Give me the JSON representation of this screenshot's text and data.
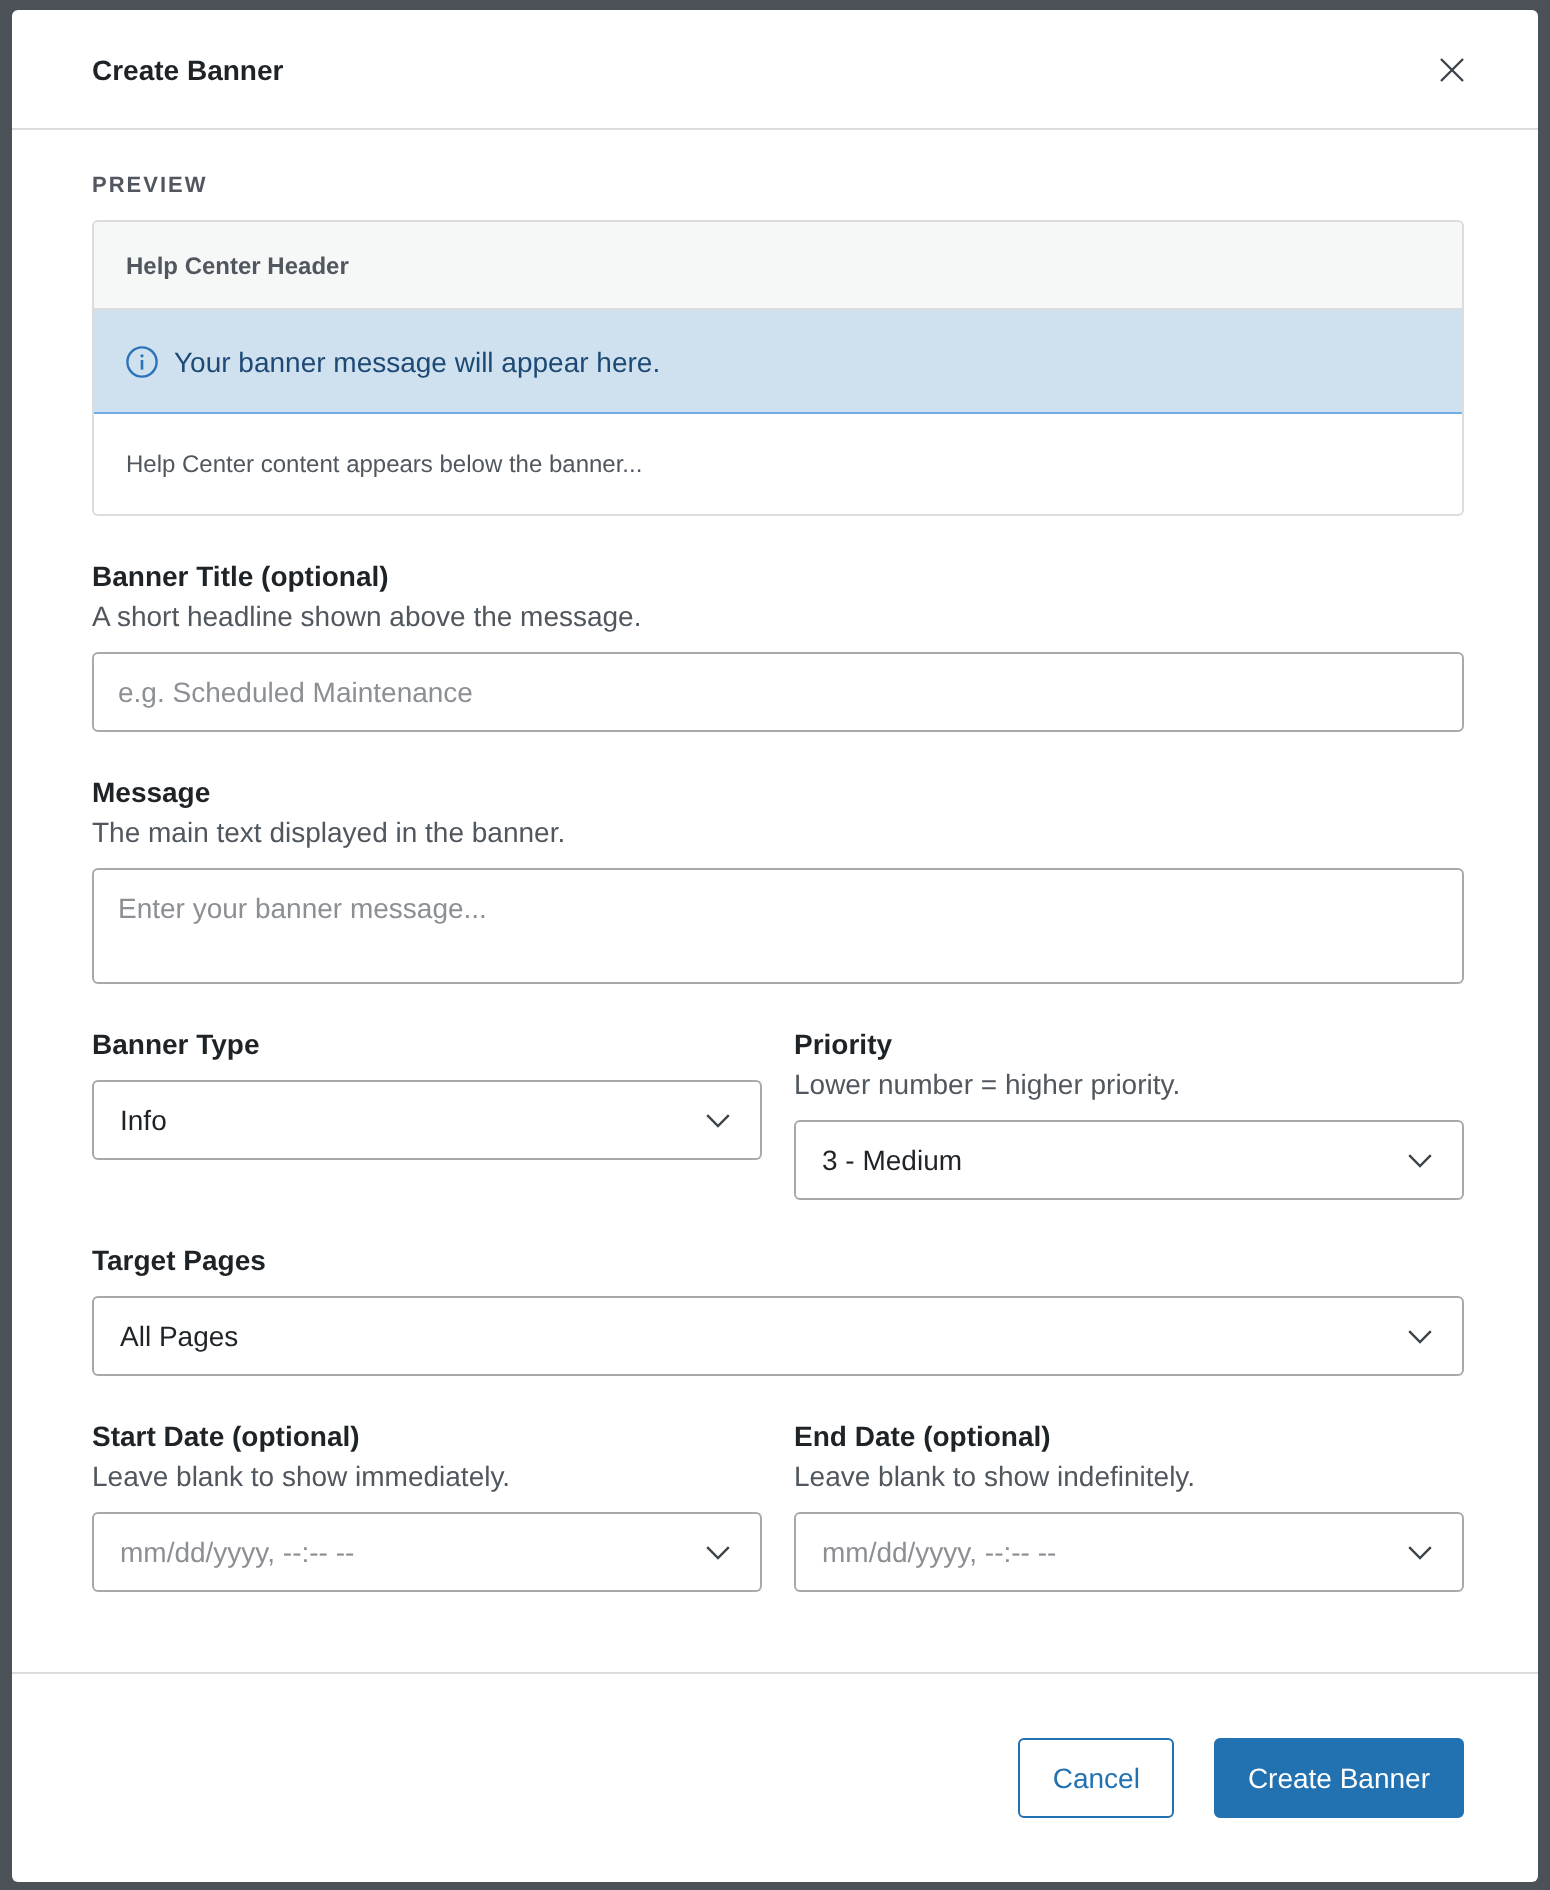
{
  "dialog": {
    "title": "Create Banner"
  },
  "preview": {
    "label": "PREVIEW",
    "header": "Help Center Header",
    "banner": {
      "kind": "info",
      "message": "Your banner message will appear here."
    },
    "content": "Help Center content appears below the banner..."
  },
  "rows": [
    {
      "fields": [
        {
          "kind": "text",
          "label": "Banner Title (optional)",
          "help": "A short headline shown above the message.",
          "placeholder": "e.g. Scheduled Maintenance"
        }
      ]
    },
    {
      "fields": [
        {
          "kind": "textarea",
          "label": "Message",
          "help": "The main text displayed in the banner.",
          "placeholder": "Enter your banner message..."
        }
      ]
    },
    {
      "fields": [
        {
          "kind": "select",
          "label": "Banner Type",
          "value": "Info"
        },
        {
          "kind": "select",
          "label": "Priority",
          "help": "Lower number = higher priority.",
          "value": "3 - Medium"
        }
      ]
    },
    {
      "fields": [
        {
          "kind": "select",
          "label": "Target Pages",
          "value": "All Pages"
        }
      ]
    },
    {
      "fields": [
        {
          "kind": "datetime",
          "label": "Start Date (optional)",
          "help": "Leave blank to show immediately.",
          "placeholder": "mm/dd/yyyy, --:-- --"
        },
        {
          "kind": "datetime",
          "label": "End Date (optional)",
          "help": "Leave blank to show indefinitely.",
          "placeholder": "mm/dd/yyyy, --:-- --"
        }
      ]
    }
  ],
  "buttons": [
    {
      "kind": "secondary",
      "label": "Cancel"
    },
    {
      "kind": "primary",
      "label": "Create Banner"
    }
  ]
}
